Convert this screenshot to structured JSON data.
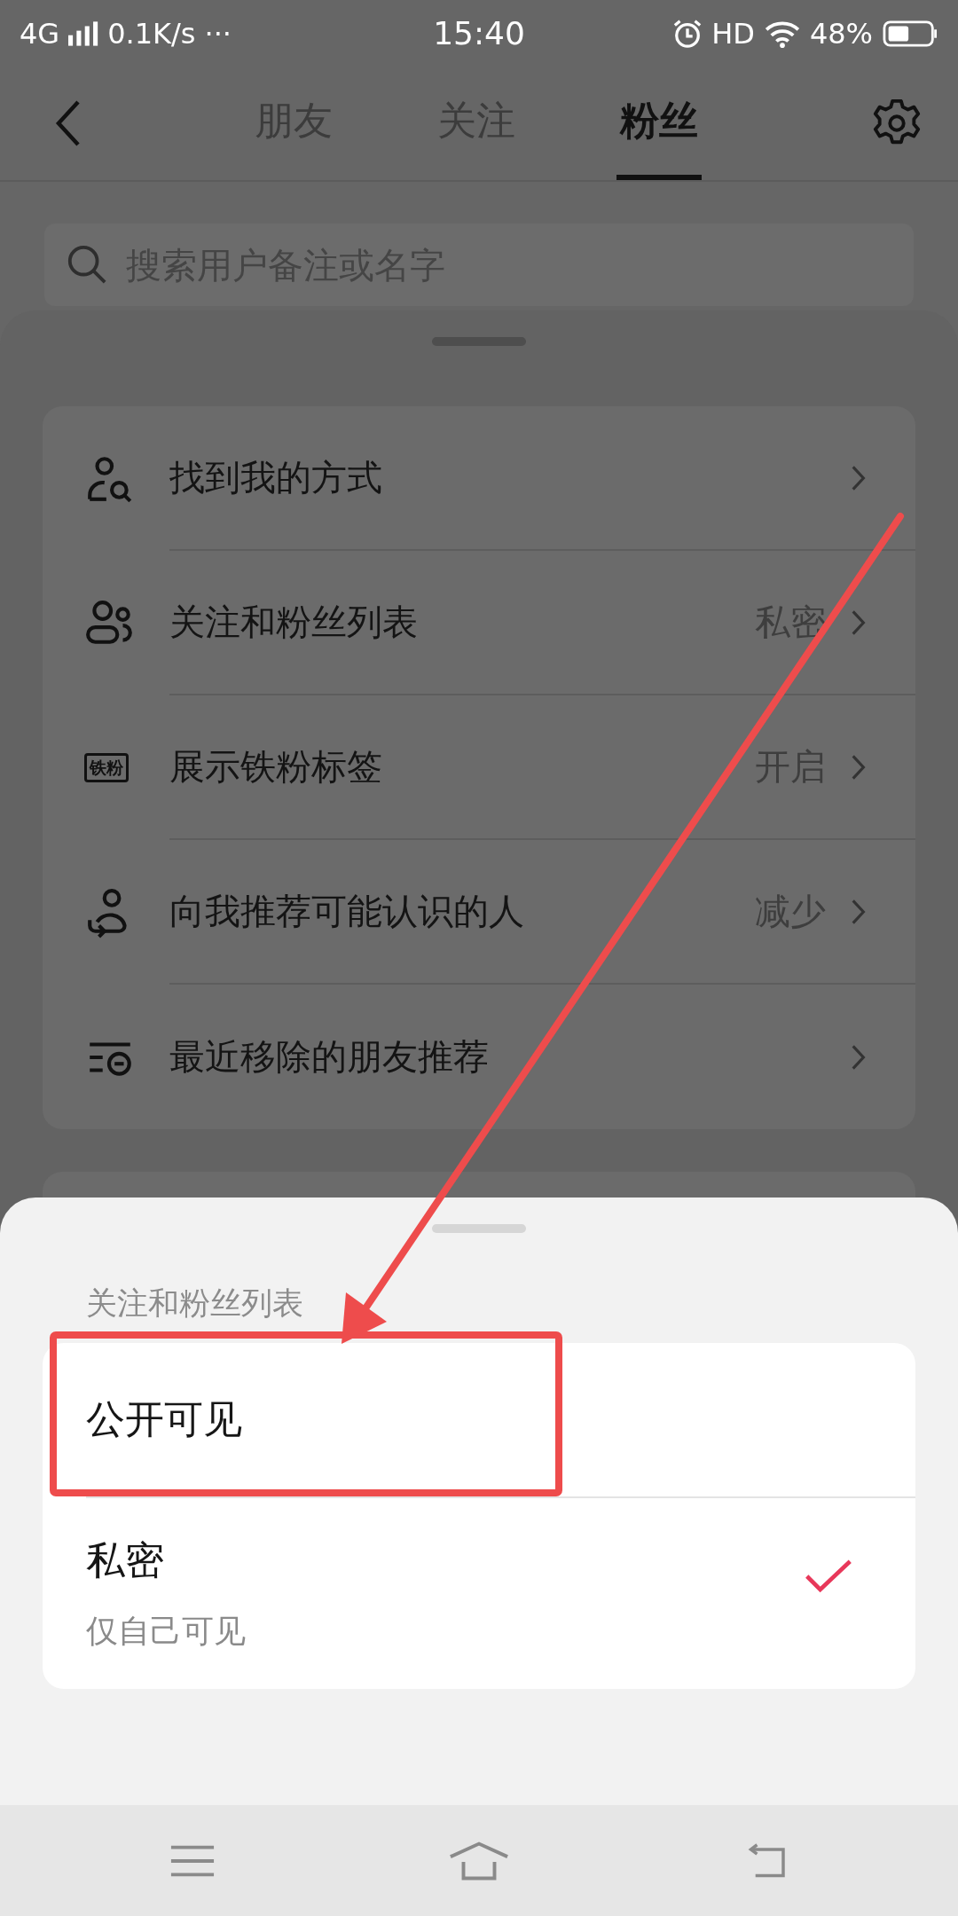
{
  "status_bar": {
    "network": "4G",
    "speed": "0.1K/s",
    "more": "···",
    "time": "15:40",
    "hd": "HD",
    "battery": "48%"
  },
  "tabs": [
    {
      "label": "朋友",
      "selected": false
    },
    {
      "label": "关注",
      "selected": false
    },
    {
      "label": "粉丝",
      "selected": true
    }
  ],
  "search": {
    "placeholder": "搜索用户备注或名字"
  },
  "settings": [
    {
      "label": "找到我的方式"
    },
    {
      "label": "关注和粉丝列表",
      "value": "私密"
    },
    {
      "label": "展示铁粉标签",
      "value": "开启",
      "badge": "铁粉"
    },
    {
      "label": "向我推荐可能认识的人",
      "value": "减少"
    },
    {
      "label": "最近移除的朋友推荐"
    }
  ],
  "sheet": {
    "title": "关注和粉丝列表",
    "options": [
      {
        "title": "公开可见",
        "selected": false
      },
      {
        "title": "私密",
        "subtitle": "仅自己可见",
        "selected": true
      }
    ]
  }
}
